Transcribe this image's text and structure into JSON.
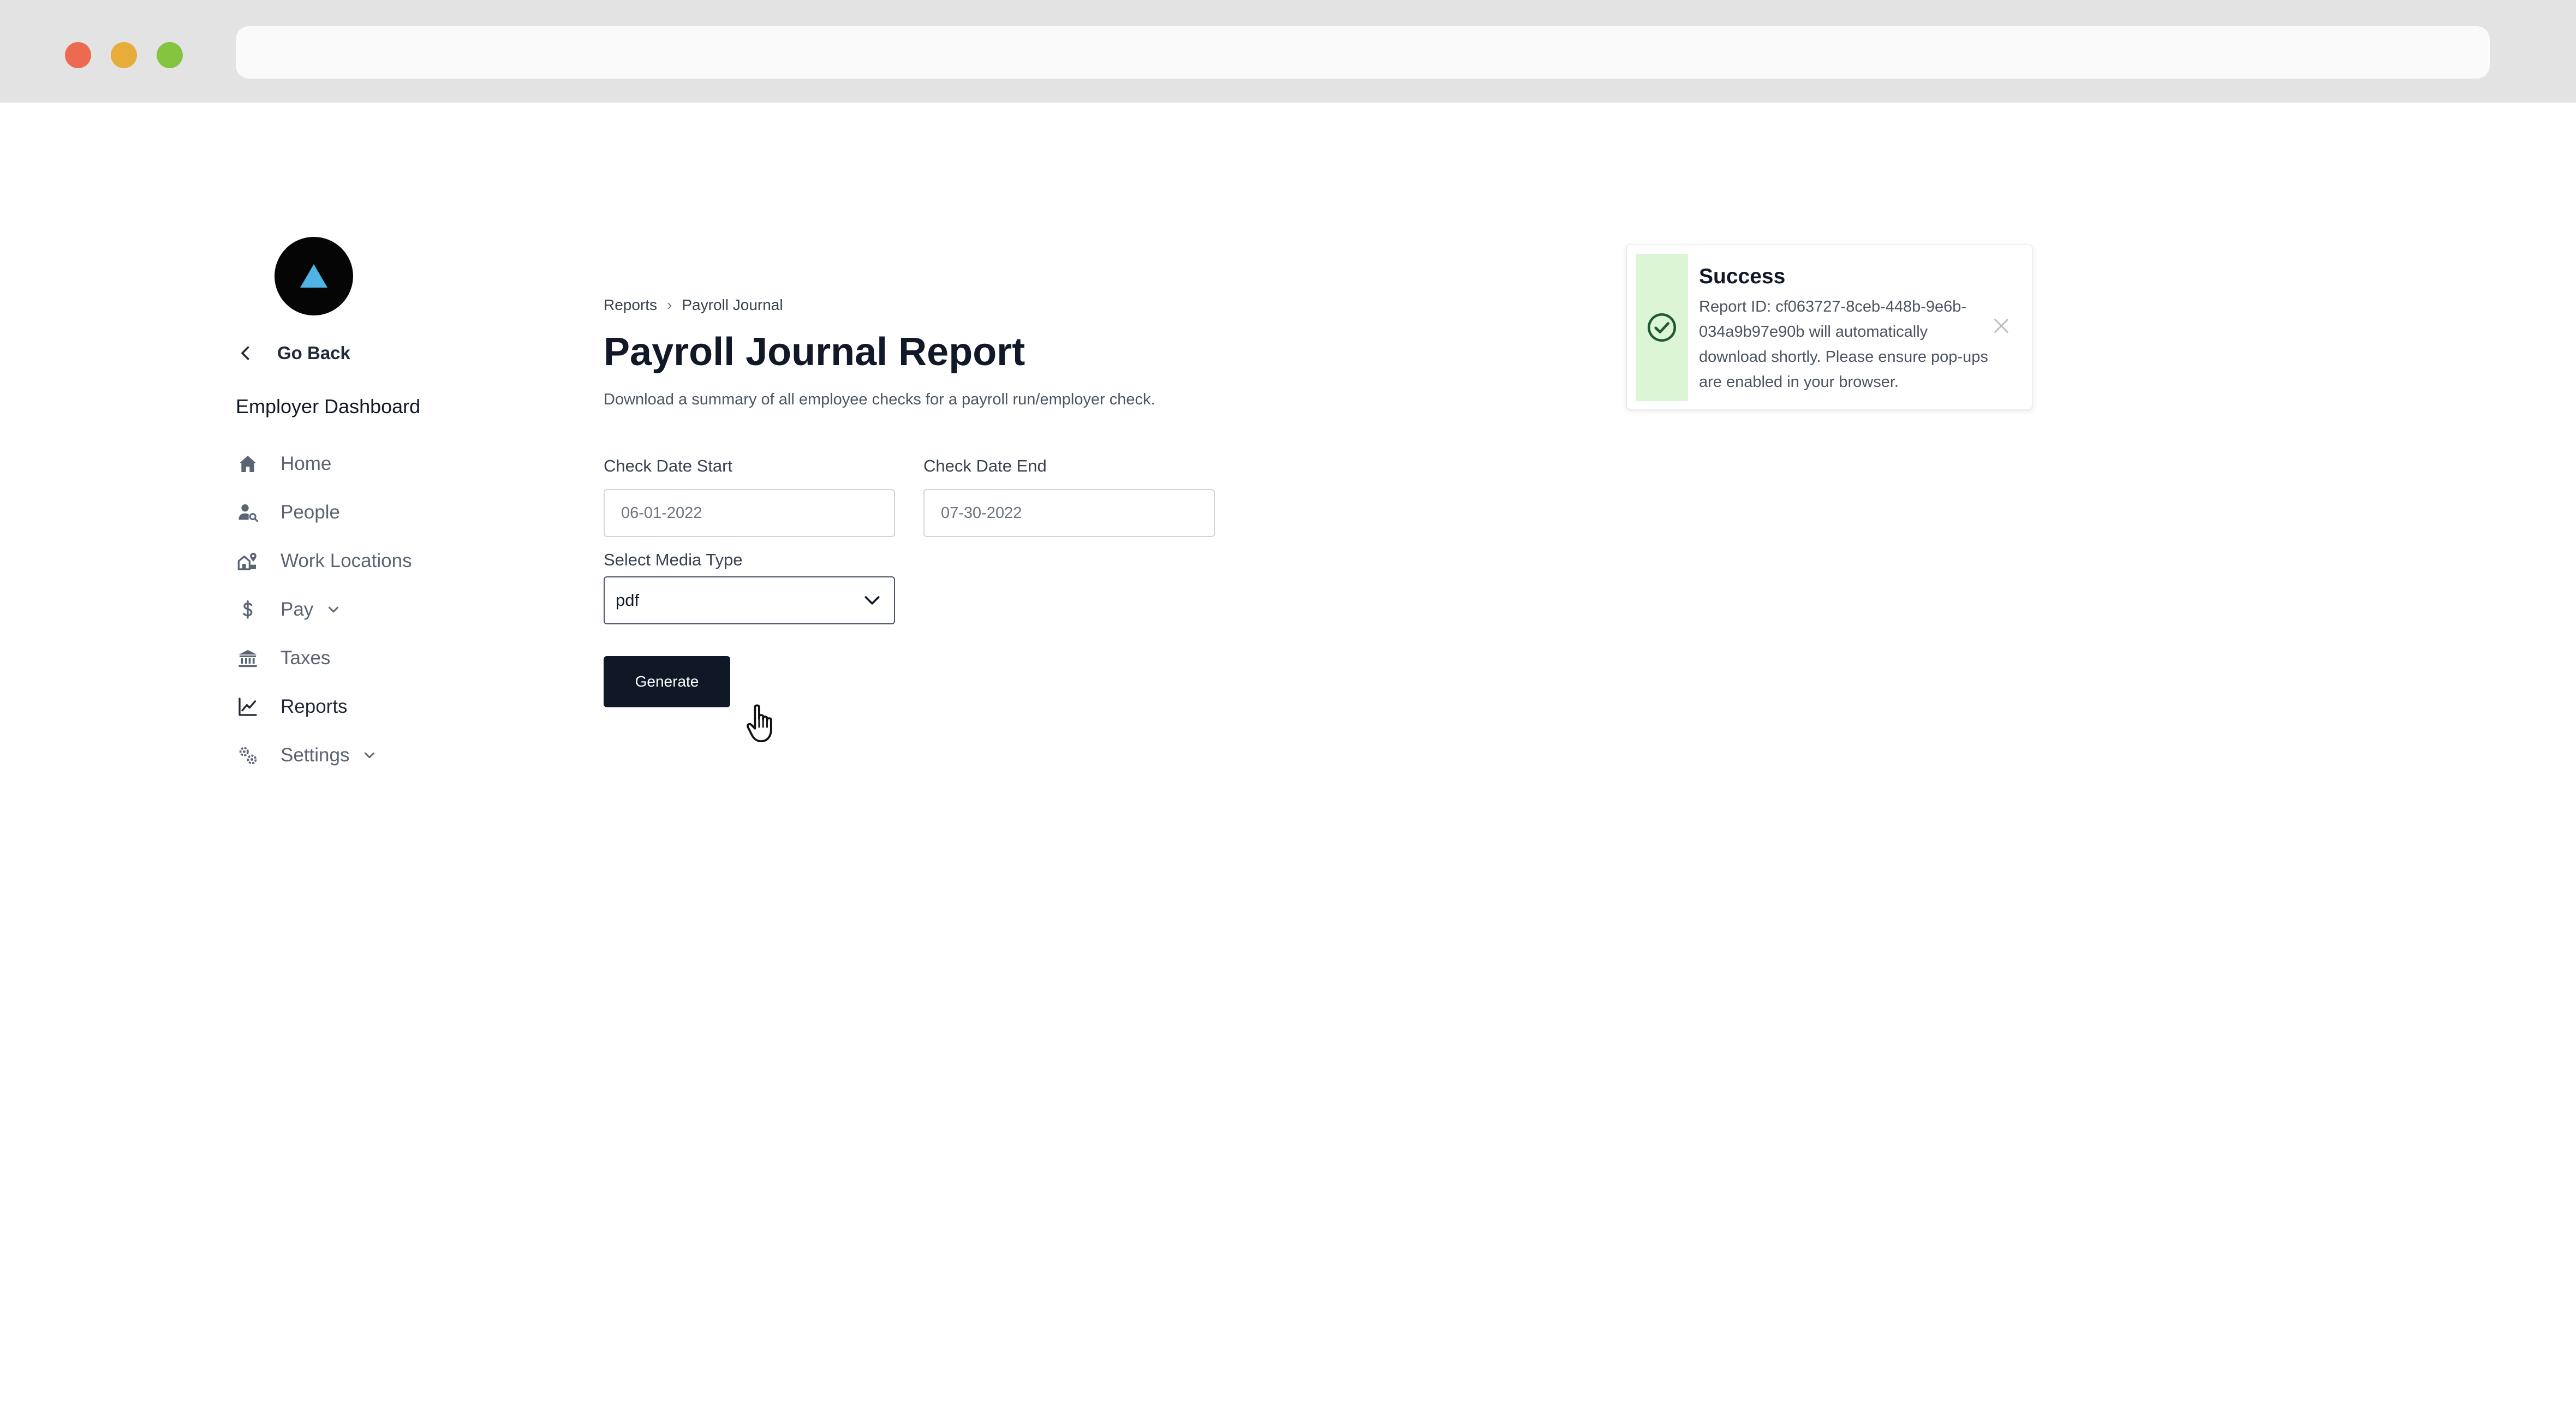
{
  "sidebar": {
    "go_back_label": "Go Back",
    "dashboard_title": "Employer Dashboard",
    "items": [
      {
        "label": "Home",
        "icon": "home-icon"
      },
      {
        "label": "People",
        "icon": "people-search-icon"
      },
      {
        "label": "Work Locations",
        "icon": "work-locations-icon"
      },
      {
        "label": "Pay",
        "icon": "dollar-icon",
        "has_submenu": true
      },
      {
        "label": "Taxes",
        "icon": "bank-icon"
      },
      {
        "label": "Reports",
        "icon": "chart-line-icon",
        "active": true
      },
      {
        "label": "Settings",
        "icon": "gears-icon",
        "has_submenu": true
      }
    ]
  },
  "breadcrumb": {
    "items": [
      "Reports",
      "Payroll Journal"
    ],
    "separator": "›"
  },
  "main": {
    "title": "Payroll Journal Report",
    "subtitle": "Download a summary of all employee checks for a payroll run/employer check.",
    "form": {
      "start_label": "Check Date Start",
      "start_value": "06-01-2022",
      "end_label": "Check Date End",
      "end_value": "07-30-2022",
      "media_label": "Select Media Type",
      "media_value": "pdf",
      "generate_label": "Generate"
    }
  },
  "toast": {
    "title": "Success",
    "message": "Report ID: cf063727-8ceb-448b-9e6b-034a9b97e90b will automatically download shortly. Please ensure pop-ups are enabled in your browser.",
    "status_color": "#dcf5d4",
    "icon": "check-circle-icon"
  },
  "colors": {
    "primary_button": "#101828",
    "logo_accent": "#4fb3e6"
  }
}
